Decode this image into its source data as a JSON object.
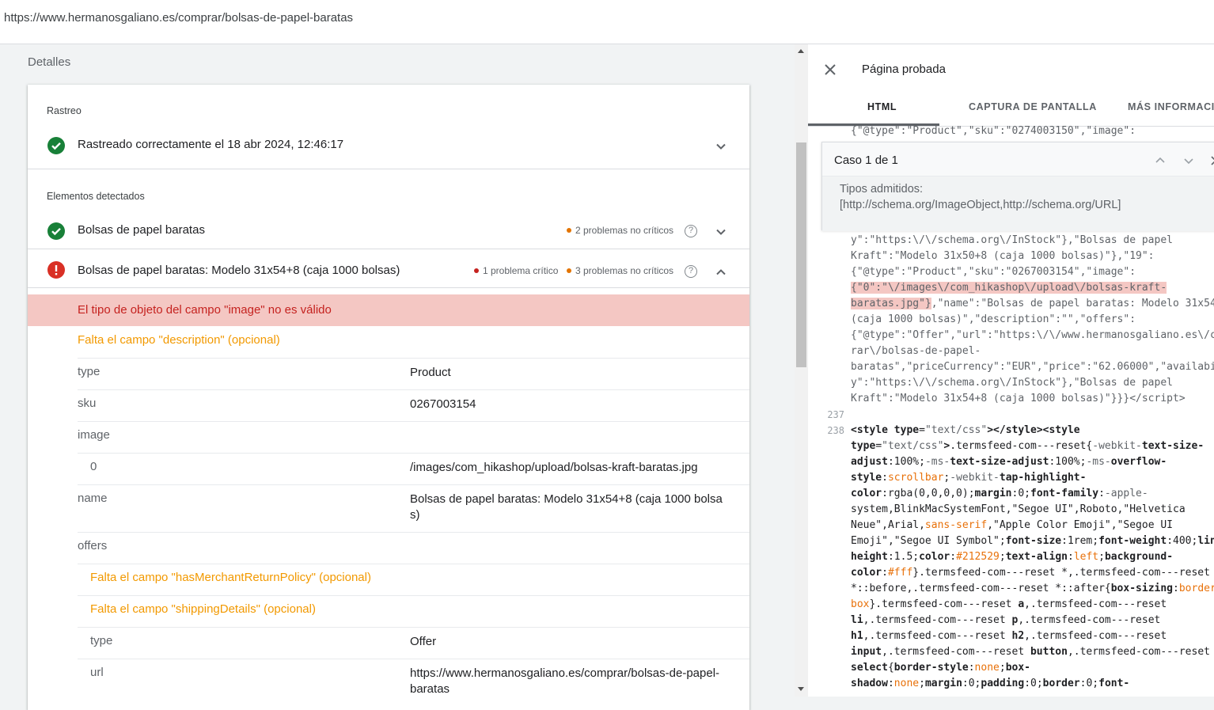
{
  "url_bar": {
    "url": "https://www.hermanosgaliano.es/comprar/bolsas-de-papel-baratas"
  },
  "left": {
    "section_title": "Detalles",
    "crawl": {
      "label": "Rastreo",
      "status": "Rastreado correctamente el 18 abr 2024, 12:46:17"
    },
    "detected": {
      "label": "Elementos detectados",
      "items": [
        {
          "name": "Bolsas de papel baratas",
          "noncritical": "2 problemas no críticos",
          "status": "ok"
        },
        {
          "name": "Bolsas de papel baratas: Modelo 31x54+8 (caja 1000 bolsas)",
          "critical": "1 problema crítico",
          "noncritical": "3 problemas no críticos",
          "status": "error"
        }
      ]
    },
    "error_message": "El tipo de objeto del campo \"image\" no es válido",
    "warnings": {
      "description": "Falta el campo \"description\" (opcional)",
      "return_policy": "Falta el campo \"hasMerchantReturnPolicy\" (opcional)",
      "shipping": "Falta el campo \"shippingDetails\" (opcional)"
    },
    "fields": {
      "type_k": "type",
      "type_v": "Product",
      "sku_k": "sku",
      "sku_v": "0267003154",
      "image_k": "image",
      "image0_k": "0",
      "image0_v": "/images/com_hikashop/upload/bolsas-kraft-baratas.jpg",
      "name_k": "name",
      "name_v": "Bolsas de papel baratas: Modelo 31x54+8 (caja 1000 bolsa s)",
      "offers_k": "offers",
      "otype_k": "type",
      "otype_v": "Offer",
      "url_k": "url",
      "url_v": "https://www.hermanosgaliano.es/comprar/bolsas-de-papel-baratas"
    },
    "help_glyph": "?"
  },
  "right": {
    "title": "Página probada",
    "tabs": [
      "HTML",
      "CAPTURA DE PANTALLA",
      "MÁS INFORMACIÓN"
    ],
    "case": {
      "title": "Caso 1 de 1",
      "line1": "Tipos admitidos:",
      "line2": "[http://schema.org/ImageObject,http://schema.org/URL]"
    },
    "line_numbers": [
      "237",
      "238"
    ],
    "code_top": "{\"@type\":\"Product\",\"sku\":\"0274003150\",\"image\":"
  }
}
